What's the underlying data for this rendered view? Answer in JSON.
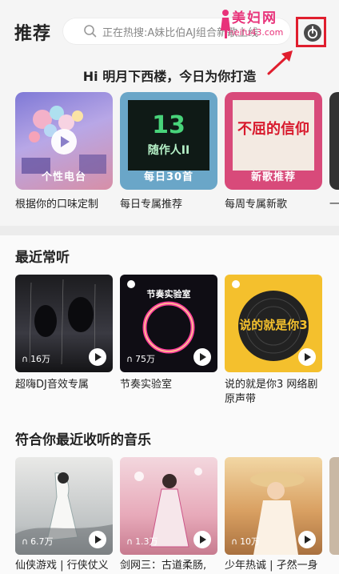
{
  "header": {
    "title": "推荐",
    "search_placeholder": "正在热搜:A妹比伯AJ组合新歌上线"
  },
  "watermark": {
    "name": "美妇网",
    "url": "meifu43.com"
  },
  "greeting": "Hi 明月下西楼，今日为你打造",
  "recommend_cards": [
    {
      "tag": "个性电台",
      "caption": "根据你的口味定制"
    },
    {
      "tag": "每日30首",
      "caption": "每日专属推荐",
      "art_text": "13",
      "art_sub": "随作人II"
    },
    {
      "tag": "新歌推荐",
      "caption": "每周专属新歌",
      "art_text": "不屈的信仰"
    },
    {
      "caption": "一"
    }
  ],
  "recent": {
    "title": "最近常听",
    "items": [
      {
        "count": "16万",
        "caption": "超嗨DJ音效专属"
      },
      {
        "count": "75万",
        "caption": "节奏实验室",
        "art_text": "节奏实验室"
      },
      {
        "count": "",
        "caption": "说的就是你3 网络剧原声带",
        "art_text": "说的就是你3"
      }
    ]
  },
  "suggest": {
    "title": "符合你最近收听的音乐",
    "items": [
      {
        "count": "6.7万",
        "caption": "仙侠游戏 | 行侠仗义"
      },
      {
        "count": "1.3万",
        "caption": "剑网三：古道柔肠,"
      },
      {
        "count": "10万",
        "caption": "少年热诚 | 孑然一身"
      }
    ]
  },
  "colors": {
    "accent": "#e01e2e",
    "watermark": "#e8327a"
  }
}
